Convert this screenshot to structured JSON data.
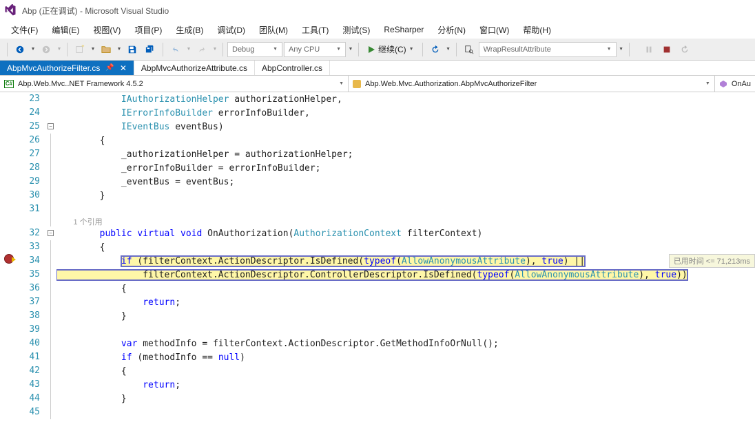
{
  "title": "Abp (正在调试) - Microsoft Visual Studio",
  "menu": [
    "文件(F)",
    "编辑(E)",
    "视图(V)",
    "项目(P)",
    "生成(B)",
    "调试(D)",
    "团队(M)",
    "工具(T)",
    "测试(S)",
    "ReSharper",
    "分析(N)",
    "窗口(W)",
    "帮助(H)"
  ],
  "toolbar": {
    "config": "Debug",
    "platform": "Any CPU",
    "continue": "继续(C)",
    "search": "WrapResultAttribute"
  },
  "tabs": [
    {
      "label": "AbpMvcAuthorizeFilter.cs",
      "active": true,
      "pinned": true
    },
    {
      "label": "AbpMvcAuthorizeAttribute.cs",
      "active": false
    },
    {
      "label": "AbpController.cs",
      "active": false
    }
  ],
  "nav": {
    "project": "Abp.Web.Mvc..NET Framework 4.5.2",
    "class": "Abp.Web.Mvc.Authorization.AbpMvcAuthorizeFilter",
    "member": "OnAu"
  },
  "debug_tip": "已用时间 <= 71,213ms",
  "refs_hint": "1 个引用",
  "lines": {
    "start": 23,
    "count": 23
  }
}
